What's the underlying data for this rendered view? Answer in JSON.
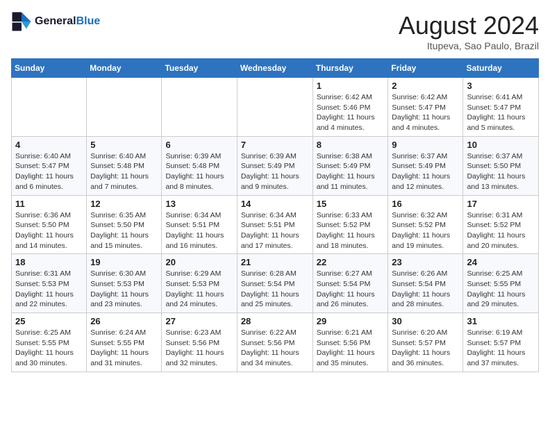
{
  "header": {
    "logo_line1": "General",
    "logo_line2": "Blue",
    "month_year": "August 2024",
    "location": "Itupeva, Sao Paulo, Brazil"
  },
  "days_of_week": [
    "Sunday",
    "Monday",
    "Tuesday",
    "Wednesday",
    "Thursday",
    "Friday",
    "Saturday"
  ],
  "weeks": [
    [
      {
        "day": "",
        "info": ""
      },
      {
        "day": "",
        "info": ""
      },
      {
        "day": "",
        "info": ""
      },
      {
        "day": "",
        "info": ""
      },
      {
        "day": "1",
        "info": "Sunrise: 6:42 AM\nSunset: 5:46 PM\nDaylight: 11 hours and 4 minutes."
      },
      {
        "day": "2",
        "info": "Sunrise: 6:42 AM\nSunset: 5:47 PM\nDaylight: 11 hours and 4 minutes."
      },
      {
        "day": "3",
        "info": "Sunrise: 6:41 AM\nSunset: 5:47 PM\nDaylight: 11 hours and 5 minutes."
      }
    ],
    [
      {
        "day": "4",
        "info": "Sunrise: 6:40 AM\nSunset: 5:47 PM\nDaylight: 11 hours and 6 minutes."
      },
      {
        "day": "5",
        "info": "Sunrise: 6:40 AM\nSunset: 5:48 PM\nDaylight: 11 hours and 7 minutes."
      },
      {
        "day": "6",
        "info": "Sunrise: 6:39 AM\nSunset: 5:48 PM\nDaylight: 11 hours and 8 minutes."
      },
      {
        "day": "7",
        "info": "Sunrise: 6:39 AM\nSunset: 5:49 PM\nDaylight: 11 hours and 9 minutes."
      },
      {
        "day": "8",
        "info": "Sunrise: 6:38 AM\nSunset: 5:49 PM\nDaylight: 11 hours and 11 minutes."
      },
      {
        "day": "9",
        "info": "Sunrise: 6:37 AM\nSunset: 5:49 PM\nDaylight: 11 hours and 12 minutes."
      },
      {
        "day": "10",
        "info": "Sunrise: 6:37 AM\nSunset: 5:50 PM\nDaylight: 11 hours and 13 minutes."
      }
    ],
    [
      {
        "day": "11",
        "info": "Sunrise: 6:36 AM\nSunset: 5:50 PM\nDaylight: 11 hours and 14 minutes."
      },
      {
        "day": "12",
        "info": "Sunrise: 6:35 AM\nSunset: 5:50 PM\nDaylight: 11 hours and 15 minutes."
      },
      {
        "day": "13",
        "info": "Sunrise: 6:34 AM\nSunset: 5:51 PM\nDaylight: 11 hours and 16 minutes."
      },
      {
        "day": "14",
        "info": "Sunrise: 6:34 AM\nSunset: 5:51 PM\nDaylight: 11 hours and 17 minutes."
      },
      {
        "day": "15",
        "info": "Sunrise: 6:33 AM\nSunset: 5:52 PM\nDaylight: 11 hours and 18 minutes."
      },
      {
        "day": "16",
        "info": "Sunrise: 6:32 AM\nSunset: 5:52 PM\nDaylight: 11 hours and 19 minutes."
      },
      {
        "day": "17",
        "info": "Sunrise: 6:31 AM\nSunset: 5:52 PM\nDaylight: 11 hours and 20 minutes."
      }
    ],
    [
      {
        "day": "18",
        "info": "Sunrise: 6:31 AM\nSunset: 5:53 PM\nDaylight: 11 hours and 22 minutes."
      },
      {
        "day": "19",
        "info": "Sunrise: 6:30 AM\nSunset: 5:53 PM\nDaylight: 11 hours and 23 minutes."
      },
      {
        "day": "20",
        "info": "Sunrise: 6:29 AM\nSunset: 5:53 PM\nDaylight: 11 hours and 24 minutes."
      },
      {
        "day": "21",
        "info": "Sunrise: 6:28 AM\nSunset: 5:54 PM\nDaylight: 11 hours and 25 minutes."
      },
      {
        "day": "22",
        "info": "Sunrise: 6:27 AM\nSunset: 5:54 PM\nDaylight: 11 hours and 26 minutes."
      },
      {
        "day": "23",
        "info": "Sunrise: 6:26 AM\nSunset: 5:54 PM\nDaylight: 11 hours and 28 minutes."
      },
      {
        "day": "24",
        "info": "Sunrise: 6:25 AM\nSunset: 5:55 PM\nDaylight: 11 hours and 29 minutes."
      }
    ],
    [
      {
        "day": "25",
        "info": "Sunrise: 6:25 AM\nSunset: 5:55 PM\nDaylight: 11 hours and 30 minutes."
      },
      {
        "day": "26",
        "info": "Sunrise: 6:24 AM\nSunset: 5:55 PM\nDaylight: 11 hours and 31 minutes."
      },
      {
        "day": "27",
        "info": "Sunrise: 6:23 AM\nSunset: 5:56 PM\nDaylight: 11 hours and 32 minutes."
      },
      {
        "day": "28",
        "info": "Sunrise: 6:22 AM\nSunset: 5:56 PM\nDaylight: 11 hours and 34 minutes."
      },
      {
        "day": "29",
        "info": "Sunrise: 6:21 AM\nSunset: 5:56 PM\nDaylight: 11 hours and 35 minutes."
      },
      {
        "day": "30",
        "info": "Sunrise: 6:20 AM\nSunset: 5:57 PM\nDaylight: 11 hours and 36 minutes."
      },
      {
        "day": "31",
        "info": "Sunrise: 6:19 AM\nSunset: 5:57 PM\nDaylight: 11 hours and 37 minutes."
      }
    ]
  ]
}
